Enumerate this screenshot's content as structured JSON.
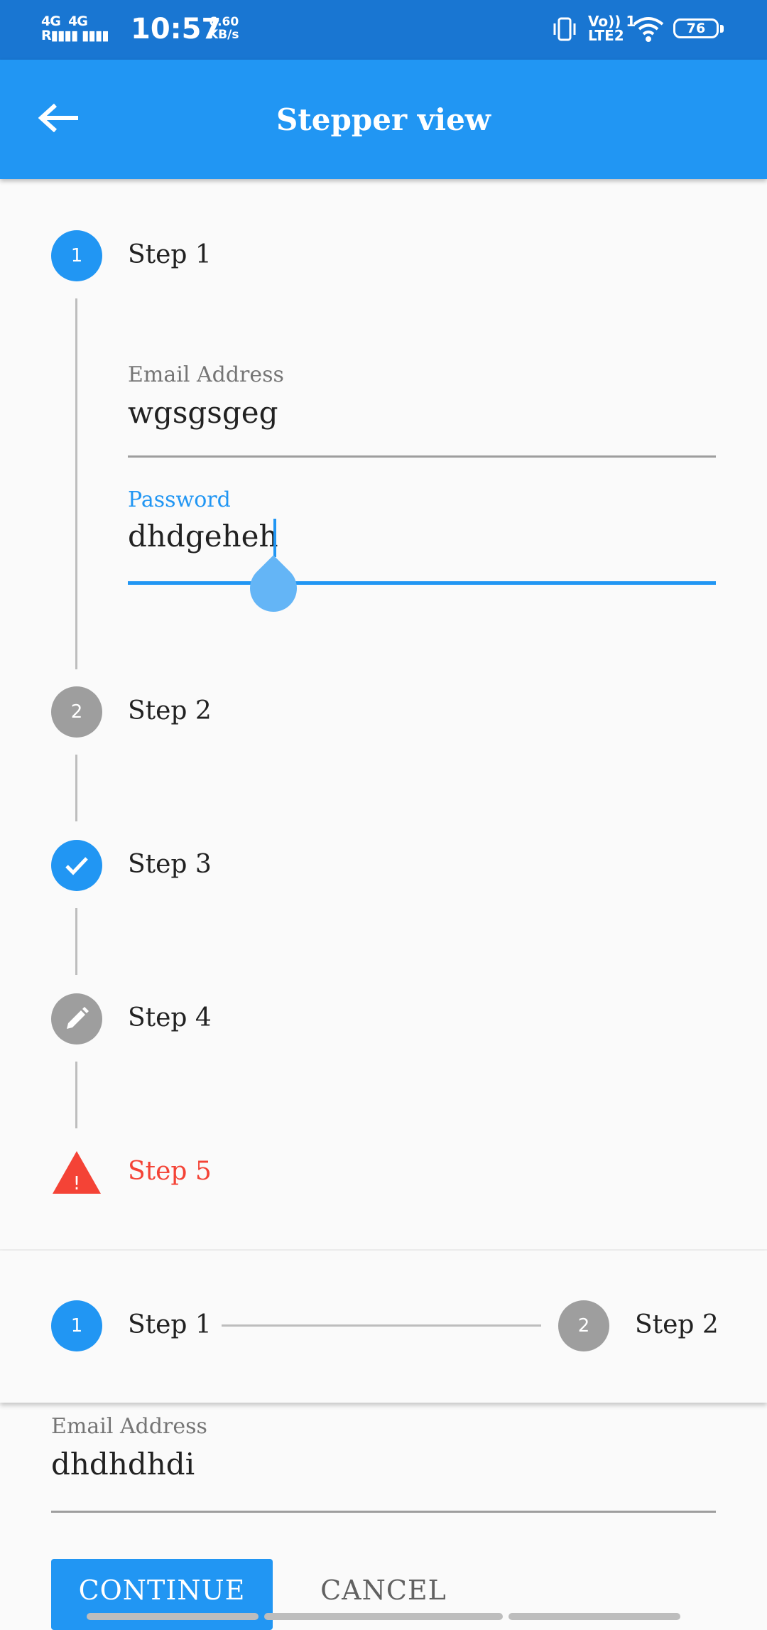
{
  "status_bar": {
    "network_1": "4G",
    "network_2": "4G",
    "time": "10:57",
    "speed_value": "6.60",
    "speed_unit": "KB/s",
    "volte": "Vo)) 1",
    "lte": "LTE2",
    "battery": "76"
  },
  "app_bar": {
    "title": "Stepper view"
  },
  "vertical_stepper": {
    "steps": [
      {
        "number": "1",
        "label": "Step 1",
        "state": "active"
      },
      {
        "number": "2",
        "label": "Step 2",
        "state": "indexed"
      },
      {
        "number": "",
        "label": "Step 3",
        "state": "complete"
      },
      {
        "number": "",
        "label": "Step 4",
        "state": "editing"
      },
      {
        "number": "!",
        "label": "Step 5",
        "state": "error"
      }
    ],
    "email": {
      "label": "Email Address",
      "value": "wgsgsgeg"
    },
    "password": {
      "label": "Password",
      "value": "dhdgeheh"
    }
  },
  "horizontal_stepper": {
    "steps": [
      {
        "number": "1",
        "label": "Step 1"
      },
      {
        "number": "2",
        "label": "Step 2"
      }
    ],
    "email": {
      "label": "Email Address",
      "value": "dhdhdhdi"
    }
  },
  "buttons": {
    "continue": "CONTINUE",
    "cancel": "CANCEL"
  },
  "colors": {
    "primary": "#2196f3",
    "status_bar": "#1976d2",
    "grey": "#9e9e9e",
    "error": "#f44336"
  }
}
